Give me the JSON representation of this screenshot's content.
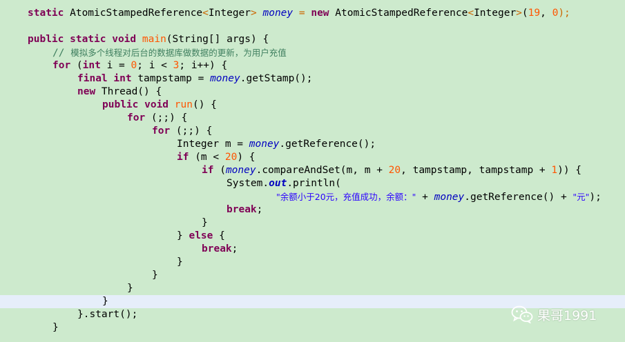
{
  "code": {
    "l0": {
      "a": "static ",
      "b": "AtomicStampedReference",
      "c": "<",
      "d": "Integer",
      "e": "> ",
      "f": "money",
      "g": " = ",
      "h": "new ",
      "i": "AtomicStampedReference",
      "j": "<",
      "k": "Integer",
      "l": ">",
      "m": "(",
      "n": "19",
      "o": ", ",
      "p": "0",
      "q": ");"
    },
    "l2": {
      "a": "public static void ",
      "b": "main",
      "c": "(String[] args) {"
    },
    "l3": {
      "a": "// ",
      "b": "模拟多个线程对后台的数据库做数据的更新，为用户充值"
    },
    "l4": {
      "a": "for ",
      "b": "(",
      "c": "int ",
      "d": "i = ",
      "e": "0",
      "f": "; i < ",
      "g": "3",
      "h": "; i++) {"
    },
    "l5": {
      "a": "final int ",
      "b": "tampstamp = ",
      "c": "money",
      "d": ".getStamp();"
    },
    "l6": {
      "a": "new ",
      "b": "Thread() {"
    },
    "l7": {
      "a": "public void ",
      "b": "run",
      "c": "() {"
    },
    "l8": {
      "a": "for ",
      "b": "(;;) {"
    },
    "l9": {
      "a": "for ",
      "b": "(;;) {"
    },
    "l10": {
      "a": "Integer m = ",
      "b": "money",
      "c": ".getReference();"
    },
    "l11": {
      "a": "if ",
      "b": "(m < ",
      "c": "20",
      "d": ") {"
    },
    "l12": {
      "a": "if ",
      "b": "(",
      "c": "money",
      "d": ".compareAndSet(m, m + ",
      "e": "20",
      "f": ", tampstamp, tampstamp + ",
      "g": "1",
      "h": ")) {"
    },
    "l13": {
      "a": "System.",
      "b": "out",
      "c": ".println("
    },
    "l14": {
      "a": "\"余额小于20元，充值成功，余额：\"",
      "b": " + ",
      "c": "money",
      "d": ".getReference() + ",
      "e": "\"元\"",
      "f": ");"
    },
    "l15": {
      "a": "break",
      "b": ";"
    },
    "l16": {
      "a": "}"
    },
    "l17": {
      "a": "} ",
      "b": "else ",
      "c": "{"
    },
    "l18": {
      "a": "break",
      "b": ";"
    },
    "l19": {
      "a": "}"
    },
    "l20": {
      "a": "}"
    },
    "l21": {
      "a": "}"
    },
    "l22": {
      "a": "}"
    },
    "l23": {
      "a": "}.start();"
    },
    "l24": {
      "a": "}"
    }
  },
  "watermark": {
    "text": "果哥1991",
    "icon": "wechat-icon"
  },
  "colors": {
    "background": "#cdeacd",
    "keyword": "#7f0055",
    "field": "#0000c0",
    "number": "#ff5500",
    "string": "#2a00ff",
    "comment": "#3f7f5f",
    "highlight": "#e6eefa"
  }
}
